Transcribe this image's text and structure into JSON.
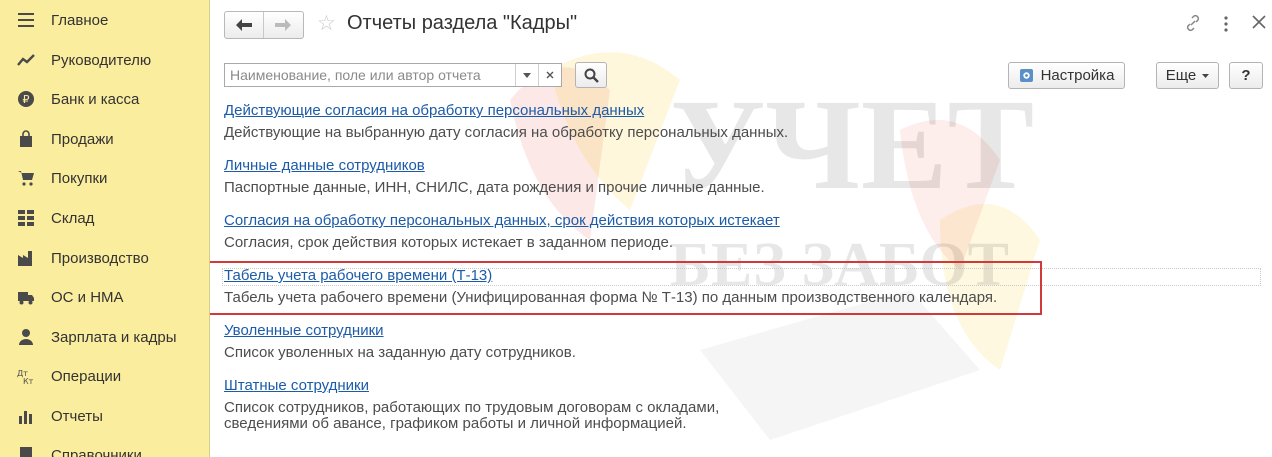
{
  "sidebar": {
    "items": [
      {
        "label": "Главное",
        "icon": "menu-lines-icon"
      },
      {
        "label": "Руководителю",
        "icon": "trend-icon"
      },
      {
        "label": "Банк и касса",
        "icon": "ruble-coin-icon"
      },
      {
        "label": "Продажи",
        "icon": "bag-icon"
      },
      {
        "label": "Покупки",
        "icon": "cart-icon"
      },
      {
        "label": "Склад",
        "icon": "grid-icon"
      },
      {
        "label": "Производство",
        "icon": "factory-icon"
      },
      {
        "label": "ОС и НМА",
        "icon": "truck-icon"
      },
      {
        "label": "Зарплата и кадры",
        "icon": "person-icon"
      },
      {
        "label": "Операции",
        "icon": "dt-kt-icon"
      },
      {
        "label": "Отчеты",
        "icon": "bar-chart-icon"
      },
      {
        "label": "Справочники",
        "icon": "book-icon"
      }
    ]
  },
  "header": {
    "title": "Отчеты раздела \"Кадры\""
  },
  "search": {
    "placeholder": "Наименование, поле или автор отчета",
    "value": ""
  },
  "toolbar": {
    "settings_label": "Настройка",
    "more_label": "Еще",
    "help_label": "?"
  },
  "watermark": {
    "line1": "УЧЕТ",
    "line2": "БЕЗ ЗАБОТ"
  },
  "reports": [
    {
      "title": "Действующие согласия на обработку персональных данных",
      "description": "Действующие на выбранную дату согласия на обработку персональных данных."
    },
    {
      "title": "Личные данные сотрудников",
      "description": "Паспортные данные, ИНН, СНИЛС, дата рождения и прочие личные данные."
    },
    {
      "title": "Согласия на обработку персональных данных, срок действия которых истекает",
      "description": "Согласия, срок действия которых истекает в заданном периоде."
    },
    {
      "title": "Табель учета рабочего времени (Т-13)",
      "description": "Табель учета рабочего времени (Унифицированная форма № Т-13) по данным производственного календаря."
    },
    {
      "title": "Уволенные сотрудники",
      "description": "Список уволенных на заданную дату сотрудников."
    },
    {
      "title": "Штатные сотрудники",
      "description": "Список сотрудников, работающих по трудовым договорам с окладами,",
      "description2": "сведениями об авансе, графиком работы и личной информацией."
    }
  ]
}
